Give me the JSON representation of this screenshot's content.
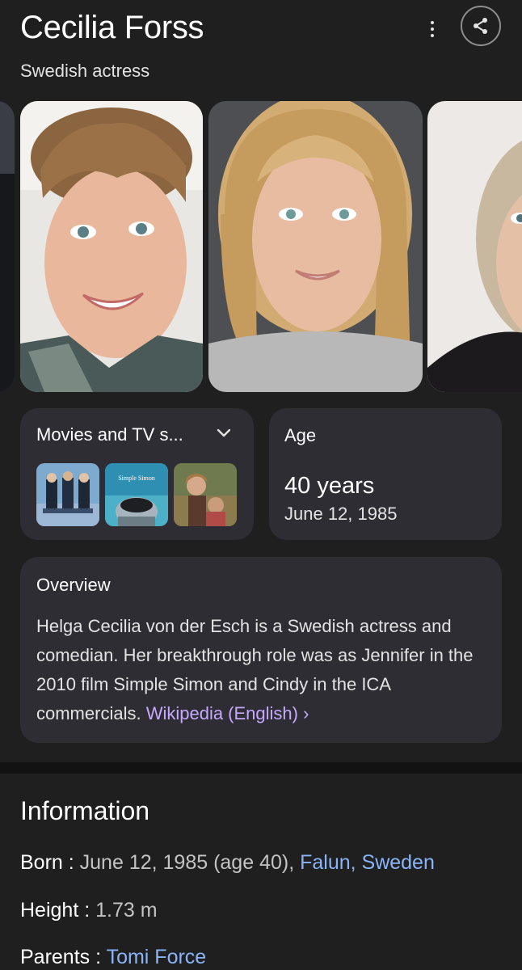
{
  "header": {
    "title": "Cecilia Forss",
    "subtitle": "Swedish actress",
    "icons": [
      "more-vert-icon",
      "share-icon"
    ]
  },
  "movies_card": {
    "label": "Movies and TV s...",
    "thumbnails": [
      "movie-thumbnail-1",
      "simple-simon-thumbnail",
      "movie-thumbnail-3"
    ],
    "thumb_caption": "Simple Simon"
  },
  "age_card": {
    "label": "Age",
    "value": "40 years",
    "date": "June 12, 1985"
  },
  "overview": {
    "label": "Overview",
    "text": "Helga Cecilia von der Esch is a Swedish actress and comedian. Her breakthrough role was as Jennifer in the 2010 film Simple Simon and Cindy in the ICA commercials.",
    "link": "Wikipedia (English) ›"
  },
  "information": {
    "title": "Information",
    "born_key": "Born :",
    "born_value": "June 12, 1985 (age 40),",
    "born_link": "Falun, Sweden",
    "height_key": "Height :",
    "height_value": "1.73 m",
    "parents_key": "Parents :",
    "parents_link": "Tomi Force"
  },
  "colors": {
    "background": "#1f1f1f",
    "card": "#2f2d34",
    "link_purple": "#c6a9ff",
    "link_blue": "#8ab4f8"
  }
}
